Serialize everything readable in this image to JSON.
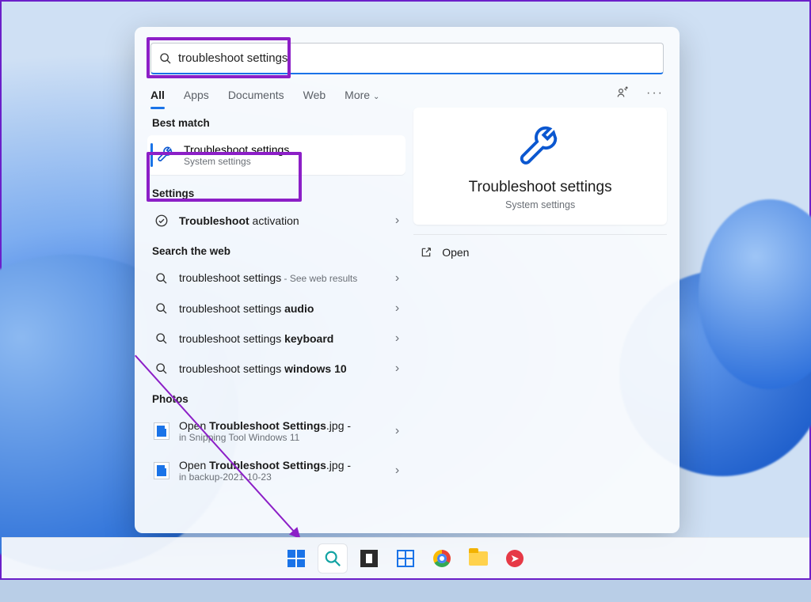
{
  "search_value": "troubleshoot settings",
  "tabs": {
    "all": "All",
    "apps": "Apps",
    "documents": "Documents",
    "web": "Web",
    "more": "More"
  },
  "sections": {
    "best_match": "Best match",
    "settings": "Settings",
    "search_web": "Search the web",
    "photos": "Photos"
  },
  "best_match": {
    "title": "Troubleshoot settings",
    "subtitle": "System settings"
  },
  "settings_item": {
    "prefix": "Troubleshoot",
    "rest": " activation"
  },
  "web_items": [
    {
      "prefix": "troubleshoot settings",
      "rest": " - See web results"
    },
    {
      "prefix": "troubleshoot settings ",
      "bold": "audio"
    },
    {
      "prefix": "troubleshoot settings ",
      "bold": "keyboard"
    },
    {
      "prefix": "troubleshoot settings ",
      "bold": "windows 10"
    }
  ],
  "photos": [
    {
      "pre": "Open ",
      "bold": "Troubleshoot Settings",
      "post": ".jpg -",
      "sub": "in Snipping Tool Windows 11"
    },
    {
      "pre": "Open ",
      "bold": "Troubleshoot Settings",
      "post": ".jpg -",
      "sub": "in backup-2021-10-23"
    }
  ],
  "right": {
    "title": "Troubleshoot settings",
    "subtitle": "System settings",
    "open": "Open"
  }
}
